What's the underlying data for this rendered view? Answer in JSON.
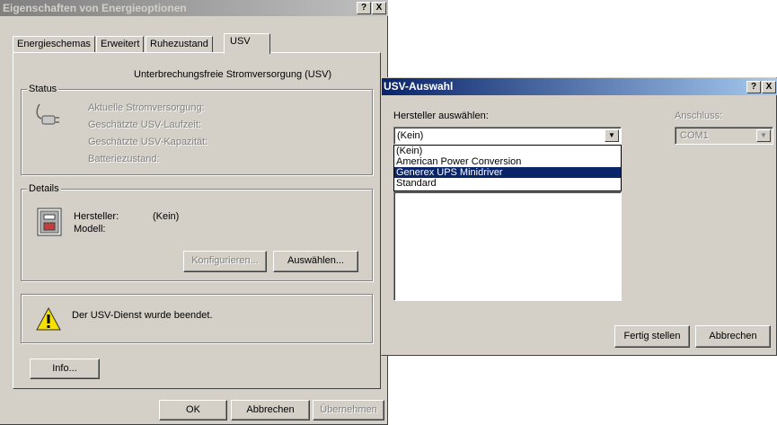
{
  "main_window": {
    "title": "Eigenschaften von Energieoptionen",
    "help_label": "?",
    "close_label": "X",
    "tabs": [
      {
        "label": "Energieschemas"
      },
      {
        "label": "Erweitert"
      },
      {
        "label": "Ruhezustand"
      },
      {
        "label": "USV"
      }
    ],
    "heading": "Unterbrechungsfreie Stromversorgung (USV)",
    "status": {
      "label": "Status",
      "lines": [
        "Aktuelle Stromversorgung:",
        "Geschätzte USV-Laufzeit:",
        "Geschätzte USV-Kapazität:",
        "Batteriezustand:"
      ]
    },
    "details": {
      "label": "Details",
      "manufacturer_label": "Hersteller:",
      "manufacturer_value": "(Kein)",
      "model_label": "Modell:",
      "configure_label": "Konfigurieren...",
      "select_label": "Auswählen..."
    },
    "warning_text": "Der USV-Dienst wurde beendet.",
    "info_label": "Info...",
    "ok_label": "OK",
    "cancel_label": "Abbrechen",
    "apply_label": "Übernehmen"
  },
  "dialog": {
    "title": "USV-Auswahl",
    "help_label": "?",
    "close_label": "X",
    "manufacturer_label": "Hersteller auswählen:",
    "manufacturer_selected": "(Kein)",
    "manufacturer_options": [
      "(Kein)",
      "American Power Conversion",
      "Generex UPS Minidriver",
      "Standard"
    ],
    "highlighted_option": "Generex UPS Minidriver",
    "port_label": "Anschluss:",
    "port_value": "COM1",
    "finish_label": "Fertig stellen",
    "cancel_label": "Abbrechen"
  },
  "icons": {
    "status": "power-plug-icon",
    "details": "ups-device-icon",
    "warning": "warning-icon",
    "dropdown": "chevron-down-icon"
  },
  "colors": {
    "inactive_title": "#808080",
    "active_title": "#0a246a",
    "selection": "#0a246a",
    "face": "#d4d0c8"
  }
}
